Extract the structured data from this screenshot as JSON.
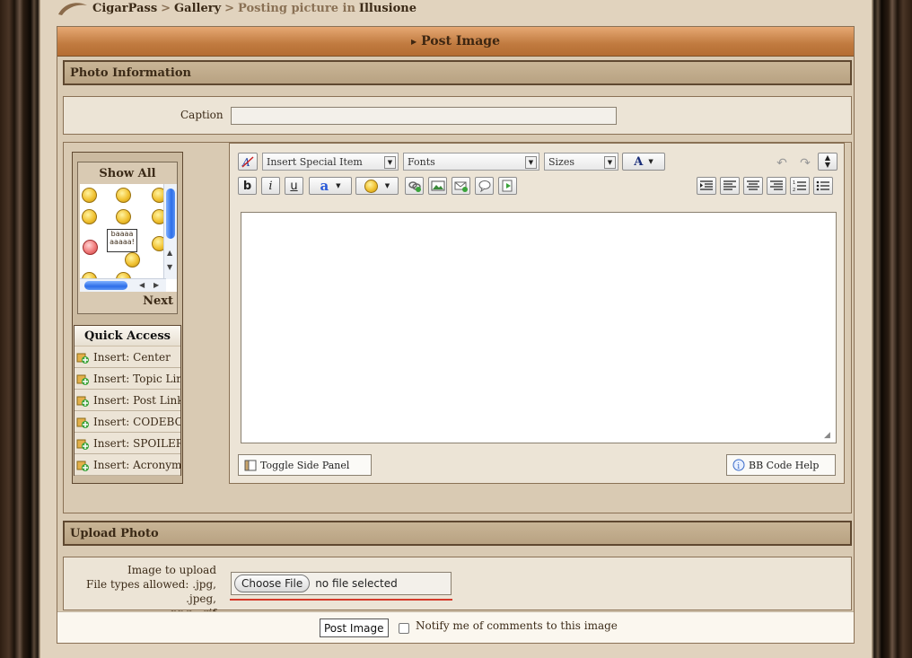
{
  "breadcrumb": {
    "site": "CigarPass",
    "sep1": ">",
    "gallery": "Gallery",
    "sep2": ">",
    "posting_prefix": "Posting picture in",
    "album": "Illusione"
  },
  "main_title": "Post Image",
  "photo_info": {
    "heading": "Photo Information",
    "caption_label": "Caption",
    "caption_value": ""
  },
  "side_panel": {
    "show_all": "Show All",
    "sign_text": "baaaa aaaaa!",
    "next": "Next",
    "quick_access_title": "Quick Access",
    "quick_items": [
      "Insert: Center",
      "Insert: Topic Link",
      "Insert: Post Link",
      "Insert: CODEBOX",
      "Insert: SPOILER",
      "Insert: Acronym"
    ]
  },
  "editor": {
    "special_item": "Insert Special Item",
    "fonts": "Fonts",
    "sizes": "Sizes",
    "bold": "b",
    "italic": "i",
    "underline": "u",
    "text_color_glyph": "a",
    "font_color_glyph": "A",
    "body": "",
    "toggle_side_panel": "Toggle Side Panel",
    "bbcode_help": "BB Code Help"
  },
  "upload": {
    "heading": "Upload Photo",
    "image_label": "Image to upload",
    "types_line1": "File types allowed: .jpg, .jpeg,",
    "types_line2": ".png, .gif",
    "choose_file": "Choose File",
    "no_file": "no file selected"
  },
  "footer": {
    "post_button": "Post Image",
    "notify_label": "Notify me of comments to this image",
    "notify_checked": false
  },
  "colors": {
    "title_bar": "#c07a3f",
    "section_bar": "#c1ab8a",
    "page_bg": "#e1d3be",
    "text": "#3b2a17"
  }
}
